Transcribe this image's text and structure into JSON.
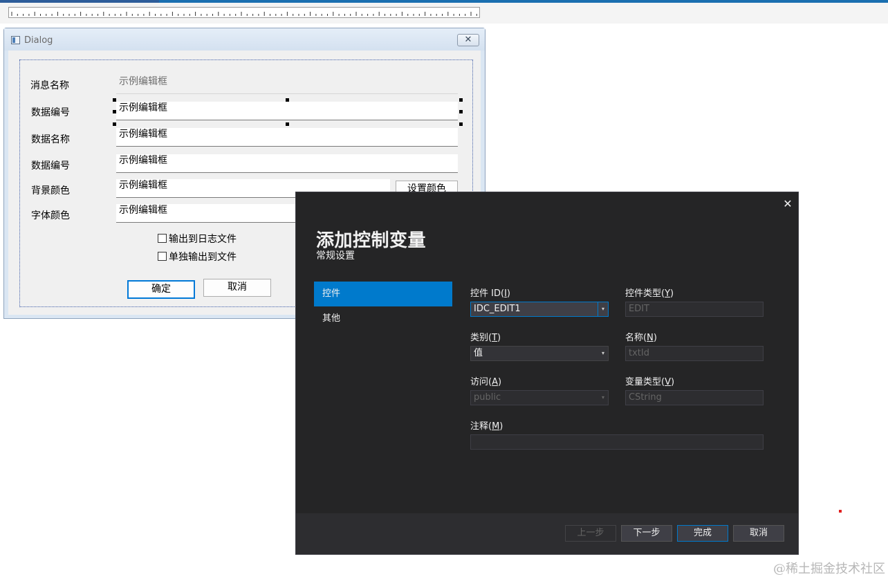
{
  "dialog": {
    "title": "Dialog",
    "close_glyph": "✕",
    "labels": [
      "消息名称",
      "数据编号",
      "数据名称",
      "数据编号",
      "背景颜色",
      "字体颜色"
    ],
    "edits": [
      "示例编辑框",
      "示例编辑框",
      "示例编辑框",
      "示例编辑框",
      "示例编辑框",
      "示例编辑框"
    ],
    "set_color_button": "设置颜色",
    "checkbox_log": "输出到日志文件",
    "checkbox_separate": "单独输出到文件",
    "ok_button": "确定",
    "cancel_button": "取消"
  },
  "wizard": {
    "close_glyph": "✕",
    "heading": "添加控制变量",
    "subheading": "常规设置",
    "nav": [
      "控件",
      "其他"
    ],
    "control_id_label": "控件 ID(",
    "control_id_key": "I",
    "control_id_value": "IDC_EDIT1",
    "control_type_label": "控件类型(",
    "control_type_key": "Y",
    "control_type_value": "EDIT",
    "category_label": "类别(",
    "category_key": "T",
    "category_value": "值",
    "name_label": "名称(",
    "name_key": "N",
    "name_value": "txtId",
    "access_label": "访问(",
    "access_key": "A",
    "access_value": "public",
    "var_type_label": "变量类型(",
    "var_type_key": "V",
    "var_type_value": "CString",
    "comment_label": "注释(",
    "comment_key": "M",
    "comment_value": "",
    "buttons": {
      "prev": "上一步",
      "next": "下一步",
      "finish": "完成",
      "cancel": "取消"
    }
  },
  "watermark": "@稀土掘金技术社区",
  "colors": {
    "accent": "#007acc",
    "wizard_bg": "#252526",
    "dialog_bg": "#f0f0f0"
  },
  "icons": [
    "dialog-app-icon",
    "close-icon",
    "dropdown-arrow-icon",
    "checkbox-icon"
  ]
}
